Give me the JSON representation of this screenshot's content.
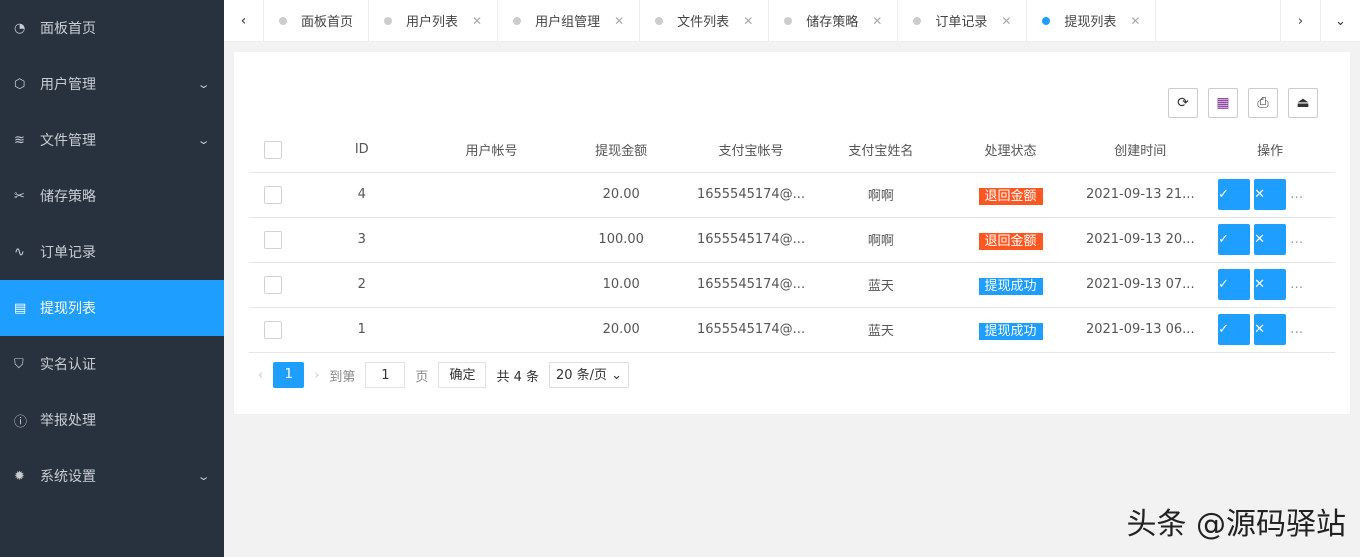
{
  "sidebar": {
    "items": [
      {
        "label": "面板首页",
        "icon": "dashboard-icon",
        "glyph": "◔",
        "expand": false
      },
      {
        "label": "用户管理",
        "icon": "cube-icon",
        "glyph": "⬡",
        "expand": true
      },
      {
        "label": "文件管理",
        "icon": "layers-icon",
        "glyph": "≋",
        "expand": true
      },
      {
        "label": "储存策略",
        "icon": "tools-icon",
        "glyph": "✂",
        "expand": false
      },
      {
        "label": "订单记录",
        "icon": "pulse-icon",
        "glyph": "∿",
        "expand": false
      },
      {
        "label": "提现列表",
        "icon": "clipboard-icon",
        "glyph": "▤",
        "expand": false,
        "active": true
      },
      {
        "label": "实名认证",
        "icon": "shield-icon",
        "glyph": "⛉",
        "expand": false
      },
      {
        "label": "举报处理",
        "icon": "info-icon",
        "glyph": "ⓘ",
        "expand": false
      },
      {
        "label": "系统设置",
        "icon": "gear-icon",
        "glyph": "✹",
        "expand": true
      }
    ]
  },
  "tabs": [
    "面板首页",
    "用户列表",
    "用户组管理",
    "文件列表",
    "储存策略",
    "订单记录",
    "提现列表"
  ],
  "table": {
    "headers": [
      "ID",
      "用户帐号",
      "提现金额",
      "支付宝帐号",
      "支付宝姓名",
      "处理状态",
      "创建时间",
      "操作"
    ],
    "rows": [
      {
        "id": "4",
        "user": "",
        "amount": "20.00",
        "alipay": "1655545174@...",
        "name": "啊啊",
        "status": "退回金额",
        "time": "2021-09-13 21..."
      },
      {
        "id": "3",
        "user": "",
        "amount": "100.00",
        "alipay": "1655545174@...",
        "name": "啊啊",
        "status": "退回金额",
        "time": "2021-09-13 20..."
      },
      {
        "id": "2",
        "user": "",
        "amount": "10.00",
        "alipay": "1655545174@...",
        "name": "蓝天",
        "status": "提现成功",
        "time": "2021-09-13 07..."
      },
      {
        "id": "1",
        "user": "",
        "amount": "20.00",
        "alipay": "1655545174@...",
        "name": "蓝天",
        "status": "提现成功",
        "time": "2021-09-13 06..."
      }
    ]
  },
  "status_colors": {
    "退回金额": "#ff5722",
    "提现成功": "#1e9fff"
  },
  "pager": {
    "current": "1",
    "goto": "到第",
    "page_value": "1",
    "page_unit": "页",
    "confirm": "确定",
    "total": "共 4 条",
    "size": "20 条/页 ⌄"
  },
  "watermark": "头条 @源码驿站"
}
